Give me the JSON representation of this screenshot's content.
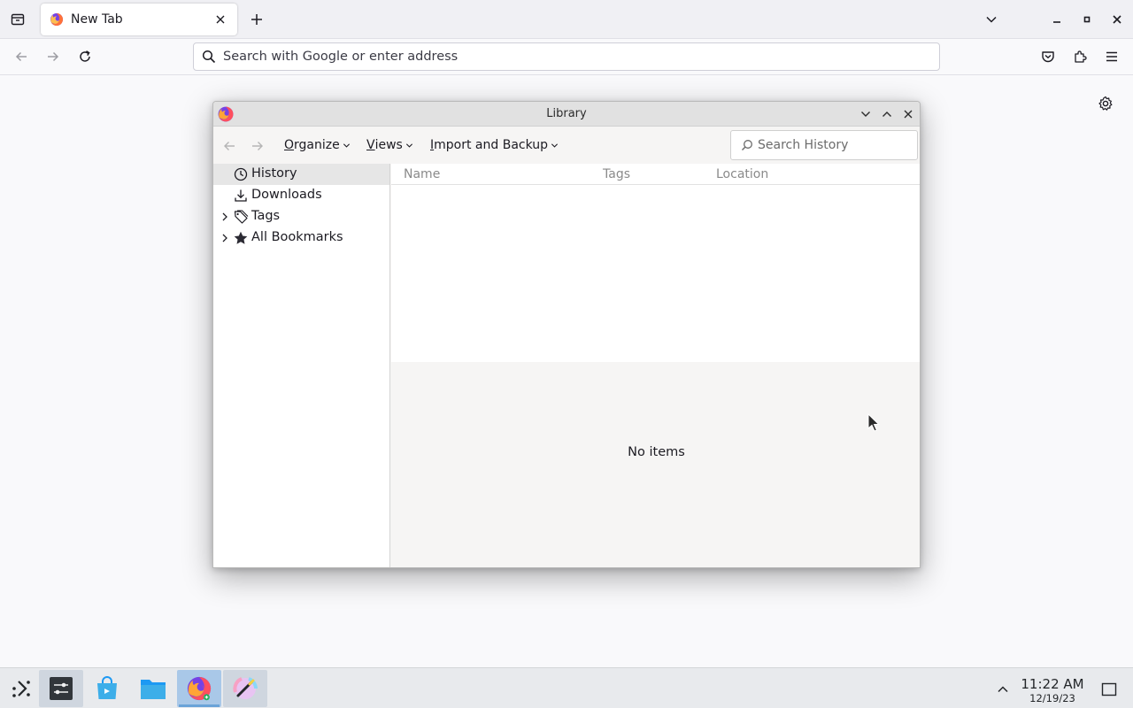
{
  "browser": {
    "tab": {
      "title": "New Tab"
    },
    "urlbar": {
      "placeholder": "Search with Google or enter address"
    }
  },
  "library": {
    "title": "Library",
    "toolbar": {
      "organize": {
        "mnemonic": "O",
        "rest": "rganize"
      },
      "views": {
        "mnemonic": "V",
        "rest": "iews"
      },
      "import_backup": {
        "mnemonic": "I",
        "rest": "mport and Backup"
      },
      "search_placeholder": "Search History"
    },
    "sidebar": {
      "items": [
        {
          "label": "History",
          "icon": "clock-icon",
          "expandable": false,
          "selected": true
        },
        {
          "label": "Downloads",
          "icon": "download-icon",
          "expandable": false,
          "selected": false
        },
        {
          "label": "Tags",
          "icon": "tag-icon",
          "expandable": true,
          "selected": false
        },
        {
          "label": "All Bookmarks",
          "icon": "star-icon",
          "expandable": true,
          "selected": false
        }
      ]
    },
    "columns": [
      "Name",
      "Tags",
      "Location"
    ],
    "empty_message": "No items"
  },
  "taskbar": {
    "apps": [
      "application-launcher",
      "system-settings",
      "discover",
      "file-manager",
      "firefox",
      "krita"
    ],
    "clock": {
      "time": "11:22 AM",
      "date": "12/19/23"
    }
  },
  "colors": {
    "tab_bar_bg": "#f0f0f4",
    "page_bg": "#f9f9fb",
    "taskbar_bg": "#e8eaed",
    "selected_item_bg": "#e6e6e6",
    "taskbar_active": "#a9c8e8"
  }
}
